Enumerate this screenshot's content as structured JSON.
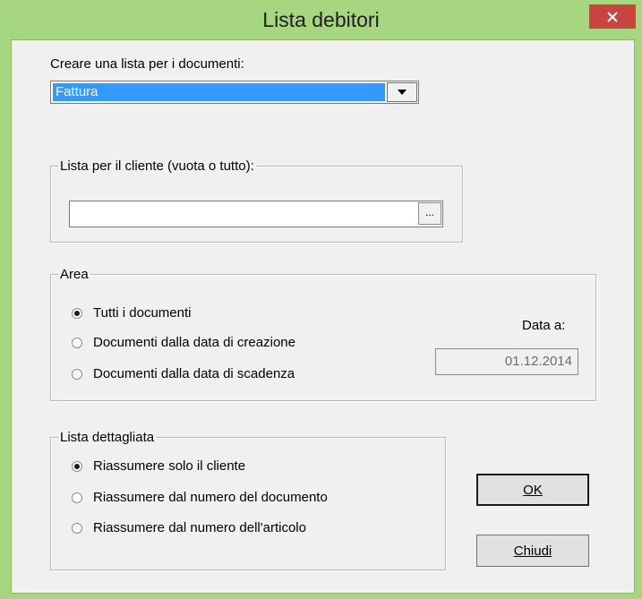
{
  "window": {
    "title": "Lista debitori",
    "close_glyph": "✕"
  },
  "documents": {
    "label": "Creare una lista per i documenti:",
    "selected": "Fattura"
  },
  "client": {
    "legend": "Lista per il cliente (vuota o tutto):",
    "value": "",
    "browse_label": "..."
  },
  "area": {
    "legend": "Area",
    "options": [
      {
        "label": "Tutti i documenti",
        "checked": true
      },
      {
        "label": "Documenti dalla data di creazione",
        "checked": false
      },
      {
        "label": "Documenti dalla data di scadenza",
        "checked": false
      }
    ],
    "date_label": "Data a:",
    "date_value": "01.12.2014"
  },
  "detail": {
    "legend": "Lista dettagliata",
    "options": [
      {
        "label": "Riassumere solo il cliente",
        "checked": true
      },
      {
        "label": "Riassumere dal numero del documento",
        "checked": false
      },
      {
        "label": "Riassumere dal numero dell'articolo",
        "checked": false
      }
    ]
  },
  "buttons": {
    "ok_label": "OK",
    "close_label": "Chiudi"
  },
  "colors": {
    "frame": "#a6d67f",
    "close_button": "#c7443f",
    "selection": "#3399ff",
    "dialog_bg": "#f0f0f0"
  }
}
